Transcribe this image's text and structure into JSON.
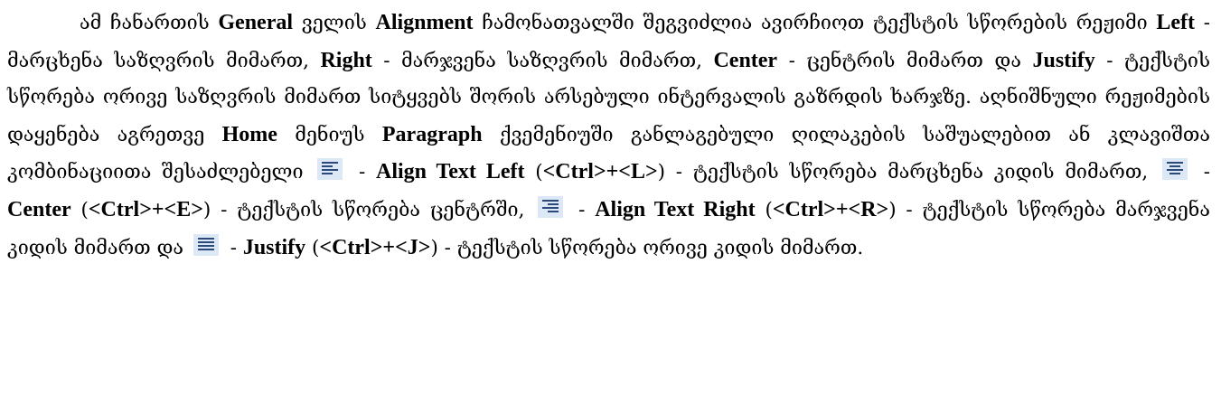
{
  "paragraph": {
    "t01": "ამ ჩანართის ",
    "k01": "General",
    "t02": " ველის ",
    "k02": "Alignment",
    "t03": " ჩამონათვალში შეგვიძლია ავირჩიოთ ტექსტის სწორების რეჟიმი ",
    "k03": "Left",
    "t04": " - მარცხენა საზღვრის მიმართ, ",
    "k04": "Right",
    "t05": " - მარჯვენა საზღვრის მიმართ, ",
    "k05": "Center",
    "t06": " - ცენტრის მიმართ და ",
    "k06": "Justify",
    "t07": " - ტექსტის სწორება ორივე საზღვრის მიმართ სიტყვებს შორის არსებული ინტერვალის გაზრდის ხარჯზე. აღნიშნული რეჟიმების დაყენება აგრეთვე ",
    "k07": "Home",
    "t08": " მენიუს ",
    "k08": "Paragraph",
    "t09": " ქვემენიუში განლაგებული ღილაკების საშუალებით ან კლავიშთა კომბინაციითა  შესაძლებელი ",
    "t10": " - ",
    "k09": "Align Text Left",
    "t11": " (",
    "k10": "<Ctrl>+<L>",
    "t12": ") - ტექსტის სწორება მარცხენა კიდის მიმართ, ",
    "t13": " - ",
    "k11": "Center",
    "t14": " (",
    "k12": "<Ctrl>+<E>",
    "t15": ") - ტექსტის სწორება ცენტრში, ",
    "t16": " - ",
    "k13": "Align Text Right",
    "t17": " (",
    "k14": "<Ctrl>+<R>",
    "t18": ") - ტექსტის სწორება მარჯვენა კიდის მიმართ და ",
    "t19": " - ",
    "k15": "Justify",
    "t20": " (",
    "k16": "<Ctrl>+<J>",
    "t21": ") - ტექსტის სწორება ორივე კიდის მიმართ."
  },
  "icons": {
    "align_left": "align-left-icon",
    "align_center": "align-center-icon",
    "align_right": "align-right-icon",
    "justify": "justify-icon",
    "icon_background": "#dce8f6",
    "icon_stroke": "#2b4a7a"
  }
}
